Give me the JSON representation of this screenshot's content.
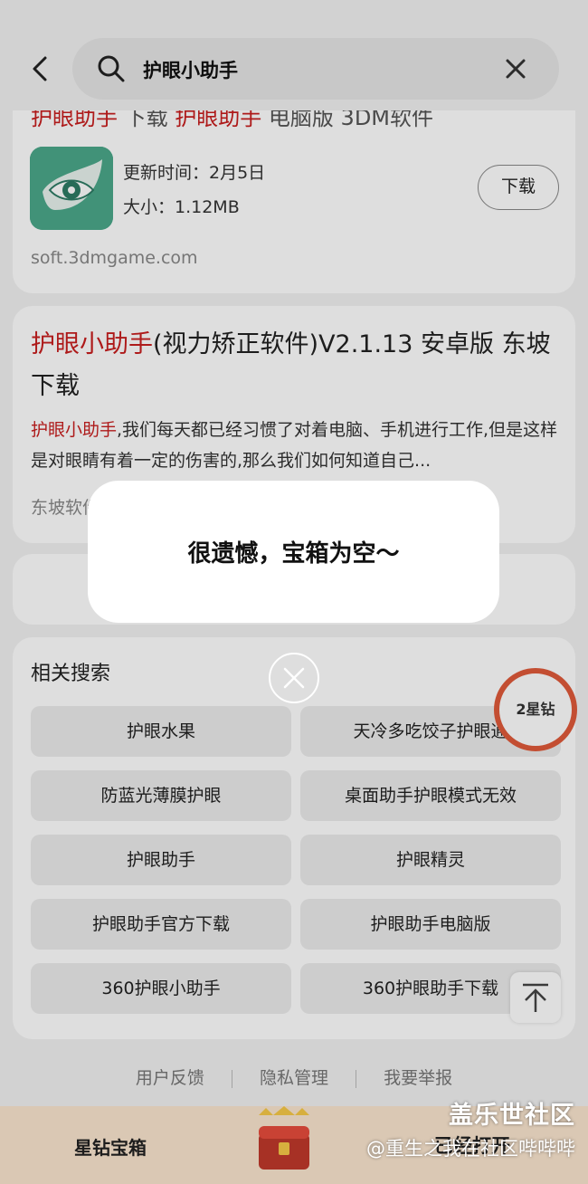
{
  "header": {
    "search_query": "护眼小助手"
  },
  "result1": {
    "clipped_title_parts": [
      "护眼助手",
      "下载",
      "护眼助手",
      "电脑版 3DM软件"
    ],
    "update_time": "更新时间：2月5日",
    "size": "大小：1.12MB",
    "download_label": "下载",
    "source": "soft.3dmgame.com"
  },
  "result2": {
    "title_highlight": "护眼小助手",
    "title_rest": "(视力矫正软件)V2.1.13 安卓版 东坡下载",
    "desc_highlight": "护眼小助手",
    "desc_rest": ",我们每天都已经习惯了对着电脑、手机进行工作,但是这样是对眼睛有着一定的伤害的,那么我们如何知道自己...",
    "source": "东坡软件"
  },
  "related": {
    "title": "相关搜索",
    "items": [
      "护眼水果",
      "天冷多吃饺子护眼通",
      "防蓝光薄膜护眼",
      "桌面助手护眼模式无效",
      "护眼助手",
      "护眼精灵",
      "护眼助手官方下载",
      "护眼助手电脑版",
      "360护眼小助手",
      "360护眼助手下载"
    ]
  },
  "star_badge": "2星钻",
  "footer": {
    "links": [
      "用户反馈",
      "隐私管理",
      "我要举报"
    ]
  },
  "bottom_bar": {
    "label": "星钻宝箱",
    "right_text": "已经打开"
  },
  "dialog": {
    "message": "很遗憾，宝箱为空～"
  },
  "watermark": {
    "line1": "盖乐世社区",
    "line2": "@重生之我在社区哔哔哔"
  },
  "colors": {
    "highlight": "#c81e1e",
    "badge_ring": "#e05a3a",
    "bottom_bar_bg": "#fbe6cf"
  },
  "icons": [
    "back-arrow-icon",
    "search-icon",
    "clear-icon",
    "eye-leaf-app-icon",
    "close-circle-icon",
    "back-to-top-icon",
    "treasure-chest-icon"
  ]
}
